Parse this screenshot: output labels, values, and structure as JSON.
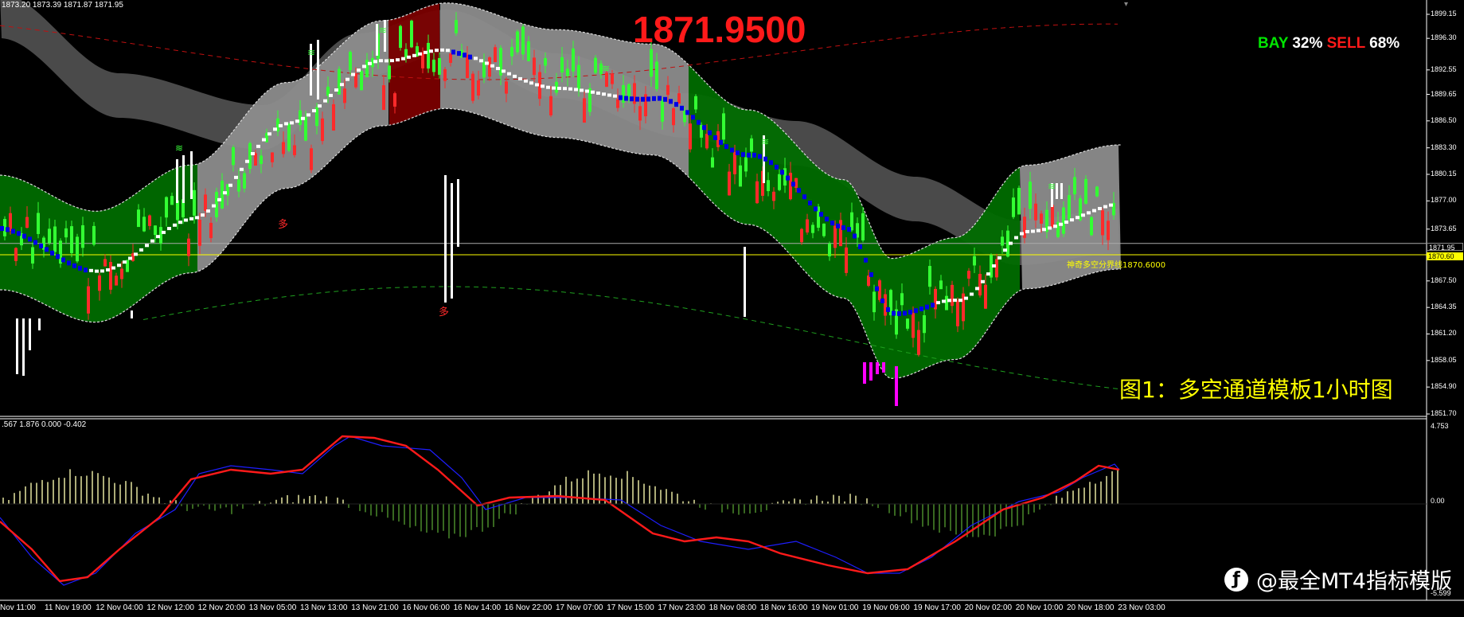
{
  "header": {
    "ohlc": "1873.20 1873.39 1871.87 1871.95",
    "big_price": "1871.9500",
    "bay_label": "BAY",
    "bay_pct": "32%",
    "sell_label": "SELL",
    "sell_pct": "68%"
  },
  "caption": "图1：多空通道模板1小时图",
  "boundary_label": "神奇多空分界线1870.6000",
  "watermark": {
    "icon": "weibo-logo-icon",
    "text": "@最全MT4指标模版"
  },
  "signal_char": "多",
  "macd_info": ".567 1.876 0.000 -0.402",
  "price_axis": {
    "ticks": [
      "1899.15",
      "1896.30",
      "1892.55",
      "1889.65",
      "1886.50",
      "1883.30",
      "1880.15",
      "1877.00",
      "1873.65",
      "1867.50",
      "1864.35",
      "1861.20",
      "1858.05",
      "1854.90",
      "1851.70"
    ],
    "current_price_tag": "1871.95",
    "boundary_tag": "1870.60",
    "current_price": 1871.95,
    "boundary_price": 1870.6
  },
  "macd_axis": {
    "ticks": [
      "4.753",
      "0.00",
      "-5.599"
    ]
  },
  "time_axis": {
    "ticks": [
      "Nov 11:00",
      "11 Nov 19:00",
      "12 Nov 04:00",
      "12 Nov 12:00",
      "12 Nov 20:00",
      "13 Nov 05:00",
      "13 Nov 13:00",
      "13 Nov 21:00",
      "16 Nov 06:00",
      "16 Nov 14:00",
      "16 Nov 22:00",
      "17 Nov 07:00",
      "17 Nov 15:00",
      "17 Nov 23:00",
      "18 Nov 08:00",
      "18 Nov 16:00",
      "19 Nov 01:00",
      "19 Nov 09:00",
      "19 Nov 17:00",
      "20 Nov 02:00",
      "20 Nov 10:00",
      "20 Nov 18:00",
      "23 Nov 03:00"
    ]
  },
  "colors": {
    "bull": "#33ff33",
    "bear": "#ff2a2a",
    "channel_green": "#006b00",
    "channel_gray": "#8c8c8c",
    "channel_dark_red": "#7a0000",
    "ma_blue": "#0000e6",
    "ma_white": "#ffffff",
    "signal_line": "#ff1a1a",
    "macd_line": "#1e1eff",
    "hist_pos": "#e6e6a0",
    "hist_neg": "#4a8a2a",
    "magenta": "#ff00ff"
  }
}
